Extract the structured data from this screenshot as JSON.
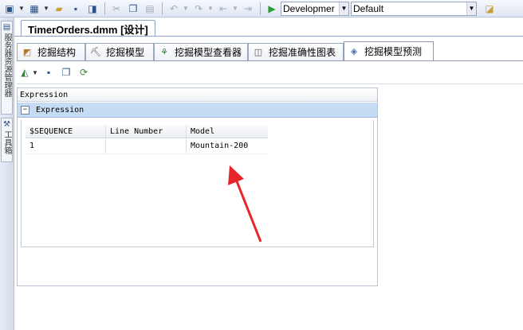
{
  "toolbar": {
    "config_combo": "Developmer",
    "platform_combo": "Default"
  },
  "leftstrip": {
    "tab1_text": "服务器资源管理器",
    "tab2_text": "工具箱"
  },
  "document": {
    "tab_title": "TimerOrders.dmm [设计]"
  },
  "designer_tabs": [
    {
      "label": "挖掘结构",
      "icon": "structure-icon"
    },
    {
      "label": "挖掘模型",
      "icon": "pickaxe-icon"
    },
    {
      "label": "挖掘模型查看器",
      "icon": "viewer-icon"
    },
    {
      "label": "挖掘准确性图表",
      "icon": "chart-icon"
    },
    {
      "label": "挖掘模型预测",
      "icon": "prediction-icon"
    }
  ],
  "active_tab_index": 4,
  "expression": {
    "header": "Expression",
    "row_label": "Expression",
    "expander": "−"
  },
  "results": {
    "columns": [
      "$SEQUENCE",
      "Line Number",
      "Model"
    ],
    "rows": [
      [
        "1",
        "",
        "Mountain-200"
      ]
    ]
  },
  "colors": {
    "selection": "#c6dcf4",
    "annotation_arrow": "#e8262a"
  }
}
